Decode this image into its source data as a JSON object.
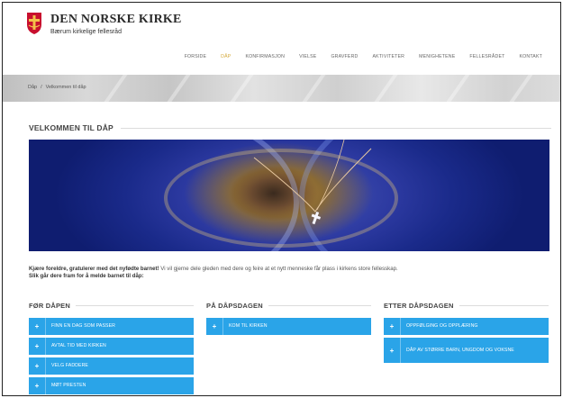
{
  "header": {
    "site_name": "DEN NORSKE KIRKE",
    "site_sub": "Bærum kirkelige fellesråd",
    "logo_icon": "church-cross-shield-icon"
  },
  "nav": {
    "items": [
      {
        "label": "FORSIDE"
      },
      {
        "label": "DÅP",
        "active": true
      },
      {
        "label": "KONFIRMASJON"
      },
      {
        "label": "VIELSE"
      },
      {
        "label": "GRAVFERD"
      },
      {
        "label": "AKTIVITETER"
      },
      {
        "label": "MENIGHETENE"
      },
      {
        "label": "FELLESRÅDET"
      },
      {
        "label": "KONTAKT"
      }
    ],
    "active_color": "#d4a93a"
  },
  "breadcrumb": {
    "home": "Dåp",
    "separator": "/",
    "current": "Velkommen til dåp"
  },
  "page": {
    "title": "VELKOMMEN TIL DÅP"
  },
  "intro": {
    "strong": "Kjære foreldre, gratulerer med det nyfødte barnet!",
    "text": " Vi vil gjerne dele gleden med dere og feire at et nytt menneske får plass i kirkens store fellesskap.",
    "line2": "Slik går dere fram for å melde barnet til dåp:"
  },
  "columns": [
    {
      "title": "FØR DÅPEN",
      "buttons": [
        {
          "label": "FINN EN DAG SOM PASSER"
        },
        {
          "label": "AVTAL TID MED KIRKEN"
        },
        {
          "label": "VELG FADDERE"
        },
        {
          "label": "MØT PRESTEN"
        }
      ]
    },
    {
      "title": "PÅ DÅPSDAGEN",
      "buttons": [
        {
          "label": "KOM TIL KIRKEN"
        }
      ]
    },
    {
      "title": "ETTER DÅPSDAGEN",
      "buttons": [
        {
          "label": "OPPFØLGING OG OPPLÆRING"
        },
        {
          "label": "DÅP AV STØRRE BARN, UNGDOM OG VOKSNE"
        }
      ]
    }
  ],
  "colors": {
    "button_blue": "#2aa4e8",
    "logo_red": "#c8102e"
  }
}
